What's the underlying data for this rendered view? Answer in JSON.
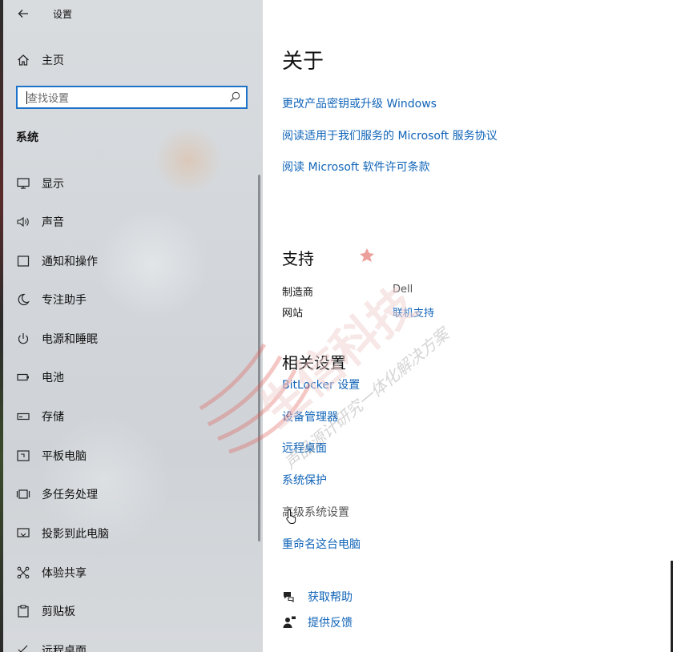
{
  "window": {
    "title": "设置"
  },
  "sidebar": {
    "home_label": "主页",
    "search": {
      "placeholder": "查找设置",
      "value": ""
    },
    "section_title": "系统",
    "items": [
      {
        "label": "显示",
        "icon": "monitor-icon"
      },
      {
        "label": "声音",
        "icon": "speaker-icon"
      },
      {
        "label": "通知和操作",
        "icon": "notification-icon"
      },
      {
        "label": "专注助手",
        "icon": "moon-icon"
      },
      {
        "label": "电源和睡眠",
        "icon": "power-icon"
      },
      {
        "label": "电池",
        "icon": "battery-icon"
      },
      {
        "label": "存储",
        "icon": "storage-icon"
      },
      {
        "label": "平板电脑",
        "icon": "tablet-icon"
      },
      {
        "label": "多任务处理",
        "icon": "multitask-icon"
      },
      {
        "label": "投影到此电脑",
        "icon": "project-icon"
      },
      {
        "label": "体验共享",
        "icon": "share-icon"
      },
      {
        "label": "剪贴板",
        "icon": "clipboard-icon"
      },
      {
        "label": "远程桌面",
        "icon": "remote-desktop-icon"
      }
    ]
  },
  "main": {
    "about_title": "关于",
    "about_links": [
      "更改产品密钥或升级 Windows",
      "阅读适用于我们服务的 Microsoft 服务协议",
      "阅读 Microsoft 软件许可条款"
    ],
    "support": {
      "title": "支持",
      "manufacturer_label": "制造商",
      "manufacturer_value": "Dell",
      "website_label": "网站",
      "website_link": "联机支持"
    },
    "related": {
      "title": "相关设置",
      "links": [
        {
          "label": "BitLocker 设置",
          "state": "link"
        },
        {
          "label": "设备管理器",
          "state": "link"
        },
        {
          "label": "远程桌面",
          "state": "link"
        },
        {
          "label": "系统保护",
          "state": "link"
        },
        {
          "label": "高级系统设置",
          "state": "hover"
        },
        {
          "label": "重命名这台电脑",
          "state": "link"
        }
      ]
    },
    "help": {
      "get_help": "获取帮助",
      "feedback": "提供反馈"
    }
  },
  "watermark": {
    "brand": "生信科技",
    "slogan": "声品源计研究一体化解决方案"
  },
  "colors": {
    "link": "#1064b8",
    "search_border": "#1e73c8",
    "sidebar_bg": "#d5d8dc",
    "watermark_red": "#e0605a"
  }
}
